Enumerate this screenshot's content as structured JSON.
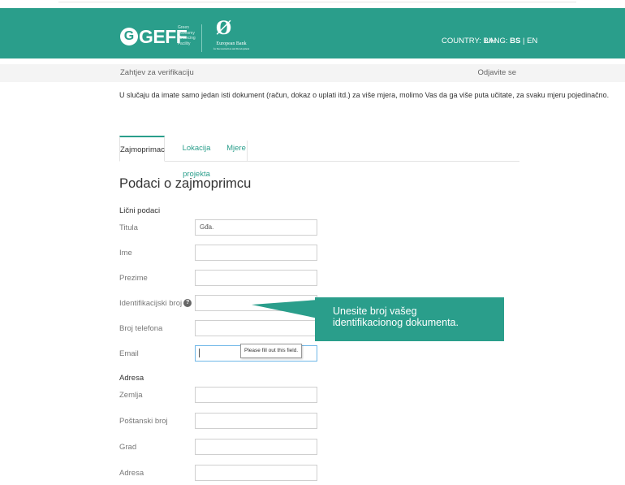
{
  "header": {
    "logo_letter": "G",
    "logo_text": "GEFF",
    "logo_subtitle": [
      "Green",
      "Economy",
      "Financing",
      "Facility"
    ],
    "ebrd_mark": "Ø",
    "ebrd_name": "European Bank",
    "ebrd_subname": "for Reconstruction and Development",
    "country_label": "COUNTRY: BIH",
    "lang_prefix": "LANG:",
    "lang_active": "BS",
    "lang_sep": "|",
    "lang_other": "EN"
  },
  "subbar": {
    "breadcrumb": "Zahtjev za verifikaciju",
    "logout": "Odjavite se"
  },
  "notice": "U slučaju da imate samo jedan isti dokument (račun, dokaz o uplati itd.) za više mjera, molimo Vas da ga više puta učitate, za svaku mjeru pojedinačno.",
  "tabs": [
    {
      "label": "Zajmoprimac"
    },
    {
      "label": "Lokacija projekta"
    },
    {
      "label": "Mjere"
    }
  ],
  "section_title": "Podaci o zajmoprimcu",
  "personal": {
    "label": "Lični podaci",
    "fields": [
      {
        "label": "Titula",
        "value": "Gđa."
      },
      {
        "label": "Ime",
        "value": ""
      },
      {
        "label": "Prezime",
        "value": ""
      },
      {
        "label": "Identifikacijski broj",
        "value": "",
        "help_icon": "?"
      },
      {
        "label": "Broj telefona",
        "value": ""
      },
      {
        "label": "Email",
        "value": ""
      }
    ]
  },
  "address": {
    "label": "Adresa",
    "fields": [
      {
        "label": "Zemlja",
        "value": ""
      },
      {
        "label": "Poštanski broj",
        "value": ""
      },
      {
        "label": "Grad",
        "value": ""
      },
      {
        "label": "Adresa",
        "value": ""
      }
    ]
  },
  "validation_message": "Please fill out this field.",
  "callout": {
    "line1": "Unesite broj vašeg",
    "line2": "identifikacionog dokumenta."
  },
  "colors": {
    "brand": "#2a9e8b",
    "subbar_bg": "#f4f4f4"
  }
}
